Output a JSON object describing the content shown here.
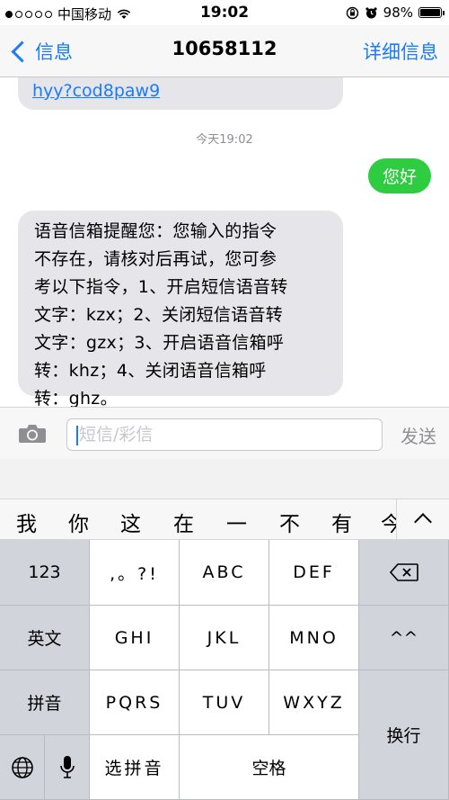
{
  "status_bar": {
    "carrier": "中国移动",
    "time": "19:02",
    "battery": "98%",
    "battery_level": 0.98
  },
  "nav": {
    "back_label": "信息",
    "title": "10658112",
    "detail_label": "详细信息"
  },
  "messages": {
    "prev_link": "hyy?cod8paw9",
    "timestamp": "今天19:02",
    "sent": "您好",
    "reply_lines": [
      "语音信箱提醒您：您输入的指令",
      "不存在，请核对后再试，您可参",
      "考以下指令，1、开启短信语音转",
      "文字：kzx；2、关闭短信语音转",
      "文字：gzx；3、开启语音信箱呼",
      "转：khz；4、关闭语音信箱呼",
      "转：ghz。"
    ]
  },
  "input": {
    "placeholder": "短信/彩信",
    "send_label": "发送"
  },
  "candidates": [
    "我",
    "你",
    "这",
    "在",
    "一",
    "不",
    "有",
    "今"
  ],
  "keyboard": {
    "row1": [
      "123",
      ",。?!",
      "ABC",
      "DEF"
    ],
    "row2": [
      "英文",
      "GHI",
      "JKL",
      "MNO",
      "^^"
    ],
    "row3": [
      "拼音",
      "PQRS",
      "TUV",
      "WXYZ"
    ],
    "newline": "换行",
    "select_pinyin": "选拼音",
    "space": "空格"
  }
}
